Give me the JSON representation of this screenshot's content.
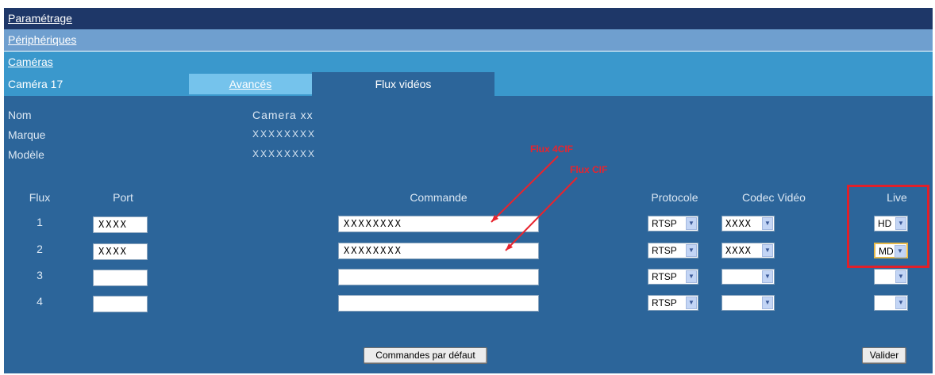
{
  "nav": {
    "level1": "Paramétrage",
    "level2": "Périphériques",
    "level3": "Caméras"
  },
  "tabs": {
    "camera_label": "Caméra 17",
    "advanced": "Avancés",
    "video_streams": "Flux vidéos"
  },
  "info": {
    "name_label": "Nom",
    "name_value": "Camera xx",
    "brand_label": "Marque",
    "brand_value": "XXXXXXXX",
    "model_label": "Modèle",
    "model_value": "XXXXXXXX"
  },
  "annotations": {
    "flux_4cif": "Flux 4CIF",
    "flux_cif": "Flux  CIF"
  },
  "table": {
    "headers": {
      "flux": "Flux",
      "port": "Port",
      "command": "Commande",
      "protocol": "Protocole",
      "codec": "Codec Vidéo",
      "live": "Live"
    },
    "rows": [
      {
        "flux": "1",
        "port": "XXXX",
        "command": "XXXXXXXX",
        "protocol": "RTSP",
        "codec": "XXXX",
        "live": "HD"
      },
      {
        "flux": "2",
        "port": "XXXX",
        "command": "XXXXXXXX",
        "protocol": "RTSP",
        "codec": "XXXX",
        "live": "MD"
      },
      {
        "flux": "3",
        "port": "",
        "command": "",
        "protocol": "RTSP",
        "codec": "",
        "live": ""
      },
      {
        "flux": "4",
        "port": "",
        "command": "",
        "protocol": "RTSP",
        "codec": "",
        "live": ""
      }
    ]
  },
  "buttons": {
    "default_commands": "Commandes par défaut",
    "validate": "Valider"
  },
  "colors": {
    "nav_dark": "#1e3768",
    "nav_mid": "#6f9fcf",
    "nav_light": "#3a98cc",
    "content_bg": "#2c659a",
    "annotation_red": "#e8242e"
  }
}
